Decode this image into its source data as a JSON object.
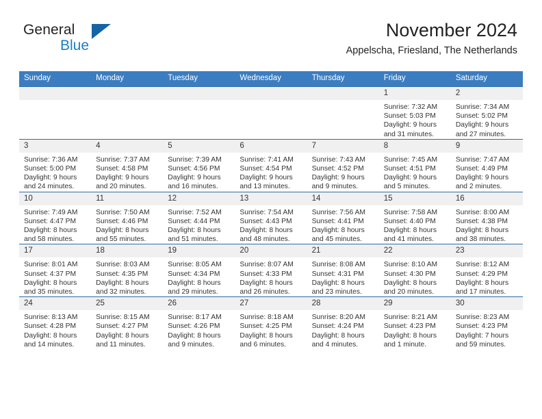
{
  "brand": {
    "name_part1": "General",
    "name_part2": "Blue"
  },
  "header": {
    "title": "November 2024",
    "subtitle": "Appelscha, Friesland, The Netherlands"
  },
  "colors": {
    "header_blue": "#3b7dc0",
    "row_divider_blue": "#2e6da8",
    "daynum_band": "#f0f0f0",
    "logo_blue": "#1b7fc4",
    "logo_triangle": "#1464a5",
    "text": "#333333"
  },
  "weekdays": [
    "Sunday",
    "Monday",
    "Tuesday",
    "Wednesday",
    "Thursday",
    "Friday",
    "Saturday"
  ],
  "labels": {
    "sunrise_prefix": "Sunrise:",
    "sunset_prefix": "Sunset:",
    "daylight_prefix": "Daylight:"
  },
  "weeks": [
    [
      {
        "day": "",
        "empty": true,
        "line1": "",
        "line2": "",
        "line3": ""
      },
      {
        "day": "",
        "empty": true,
        "line1": "",
        "line2": "",
        "line3": ""
      },
      {
        "day": "",
        "empty": true,
        "line1": "",
        "line2": "",
        "line3": ""
      },
      {
        "day": "",
        "empty": true,
        "line1": "",
        "line2": "",
        "line3": ""
      },
      {
        "day": "",
        "empty": true,
        "line1": "",
        "line2": "",
        "line3": ""
      },
      {
        "day": "1",
        "empty": false,
        "line1": "Sunrise: 7:32 AM",
        "line2": "Sunset: 5:03 PM",
        "line3": "Daylight: 9 hours and 31 minutes."
      },
      {
        "day": "2",
        "empty": false,
        "line1": "Sunrise: 7:34 AM",
        "line2": "Sunset: 5:02 PM",
        "line3": "Daylight: 9 hours and 27 minutes."
      }
    ],
    [
      {
        "day": "3",
        "empty": false,
        "line1": "Sunrise: 7:36 AM",
        "line2": "Sunset: 5:00 PM",
        "line3": "Daylight: 9 hours and 24 minutes."
      },
      {
        "day": "4",
        "empty": false,
        "line1": "Sunrise: 7:37 AM",
        "line2": "Sunset: 4:58 PM",
        "line3": "Daylight: 9 hours and 20 minutes."
      },
      {
        "day": "5",
        "empty": false,
        "line1": "Sunrise: 7:39 AM",
        "line2": "Sunset: 4:56 PM",
        "line3": "Daylight: 9 hours and 16 minutes."
      },
      {
        "day": "6",
        "empty": false,
        "line1": "Sunrise: 7:41 AM",
        "line2": "Sunset: 4:54 PM",
        "line3": "Daylight: 9 hours and 13 minutes."
      },
      {
        "day": "7",
        "empty": false,
        "line1": "Sunrise: 7:43 AM",
        "line2": "Sunset: 4:52 PM",
        "line3": "Daylight: 9 hours and 9 minutes."
      },
      {
        "day": "8",
        "empty": false,
        "line1": "Sunrise: 7:45 AM",
        "line2": "Sunset: 4:51 PM",
        "line3": "Daylight: 9 hours and 5 minutes."
      },
      {
        "day": "9",
        "empty": false,
        "line1": "Sunrise: 7:47 AM",
        "line2": "Sunset: 4:49 PM",
        "line3": "Daylight: 9 hours and 2 minutes."
      }
    ],
    [
      {
        "day": "10",
        "empty": false,
        "line1": "Sunrise: 7:49 AM",
        "line2": "Sunset: 4:47 PM",
        "line3": "Daylight: 8 hours and 58 minutes."
      },
      {
        "day": "11",
        "empty": false,
        "line1": "Sunrise: 7:50 AM",
        "line2": "Sunset: 4:46 PM",
        "line3": "Daylight: 8 hours and 55 minutes."
      },
      {
        "day": "12",
        "empty": false,
        "line1": "Sunrise: 7:52 AM",
        "line2": "Sunset: 4:44 PM",
        "line3": "Daylight: 8 hours and 51 minutes."
      },
      {
        "day": "13",
        "empty": false,
        "line1": "Sunrise: 7:54 AM",
        "line2": "Sunset: 4:43 PM",
        "line3": "Daylight: 8 hours and 48 minutes."
      },
      {
        "day": "14",
        "empty": false,
        "line1": "Sunrise: 7:56 AM",
        "line2": "Sunset: 4:41 PM",
        "line3": "Daylight: 8 hours and 45 minutes."
      },
      {
        "day": "15",
        "empty": false,
        "line1": "Sunrise: 7:58 AM",
        "line2": "Sunset: 4:40 PM",
        "line3": "Daylight: 8 hours and 41 minutes."
      },
      {
        "day": "16",
        "empty": false,
        "line1": "Sunrise: 8:00 AM",
        "line2": "Sunset: 4:38 PM",
        "line3": "Daylight: 8 hours and 38 minutes."
      }
    ],
    [
      {
        "day": "17",
        "empty": false,
        "line1": "Sunrise: 8:01 AM",
        "line2": "Sunset: 4:37 PM",
        "line3": "Daylight: 8 hours and 35 minutes."
      },
      {
        "day": "18",
        "empty": false,
        "line1": "Sunrise: 8:03 AM",
        "line2": "Sunset: 4:35 PM",
        "line3": "Daylight: 8 hours and 32 minutes."
      },
      {
        "day": "19",
        "empty": false,
        "line1": "Sunrise: 8:05 AM",
        "line2": "Sunset: 4:34 PM",
        "line3": "Daylight: 8 hours and 29 minutes."
      },
      {
        "day": "20",
        "empty": false,
        "line1": "Sunrise: 8:07 AM",
        "line2": "Sunset: 4:33 PM",
        "line3": "Daylight: 8 hours and 26 minutes."
      },
      {
        "day": "21",
        "empty": false,
        "line1": "Sunrise: 8:08 AM",
        "line2": "Sunset: 4:31 PM",
        "line3": "Daylight: 8 hours and 23 minutes."
      },
      {
        "day": "22",
        "empty": false,
        "line1": "Sunrise: 8:10 AM",
        "line2": "Sunset: 4:30 PM",
        "line3": "Daylight: 8 hours and 20 minutes."
      },
      {
        "day": "23",
        "empty": false,
        "line1": "Sunrise: 8:12 AM",
        "line2": "Sunset: 4:29 PM",
        "line3": "Daylight: 8 hours and 17 minutes."
      }
    ],
    [
      {
        "day": "24",
        "empty": false,
        "line1": "Sunrise: 8:13 AM",
        "line2": "Sunset: 4:28 PM",
        "line3": "Daylight: 8 hours and 14 minutes."
      },
      {
        "day": "25",
        "empty": false,
        "line1": "Sunrise: 8:15 AM",
        "line2": "Sunset: 4:27 PM",
        "line3": "Daylight: 8 hours and 11 minutes."
      },
      {
        "day": "26",
        "empty": false,
        "line1": "Sunrise: 8:17 AM",
        "line2": "Sunset: 4:26 PM",
        "line3": "Daylight: 8 hours and 9 minutes."
      },
      {
        "day": "27",
        "empty": false,
        "line1": "Sunrise: 8:18 AM",
        "line2": "Sunset: 4:25 PM",
        "line3": "Daylight: 8 hours and 6 minutes."
      },
      {
        "day": "28",
        "empty": false,
        "line1": "Sunrise: 8:20 AM",
        "line2": "Sunset: 4:24 PM",
        "line3": "Daylight: 8 hours and 4 minutes."
      },
      {
        "day": "29",
        "empty": false,
        "line1": "Sunrise: 8:21 AM",
        "line2": "Sunset: 4:23 PM",
        "line3": "Daylight: 8 hours and 1 minute."
      },
      {
        "day": "30",
        "empty": false,
        "line1": "Sunrise: 8:23 AM",
        "line2": "Sunset: 4:23 PM",
        "line3": "Daylight: 7 hours and 59 minutes."
      }
    ]
  ]
}
